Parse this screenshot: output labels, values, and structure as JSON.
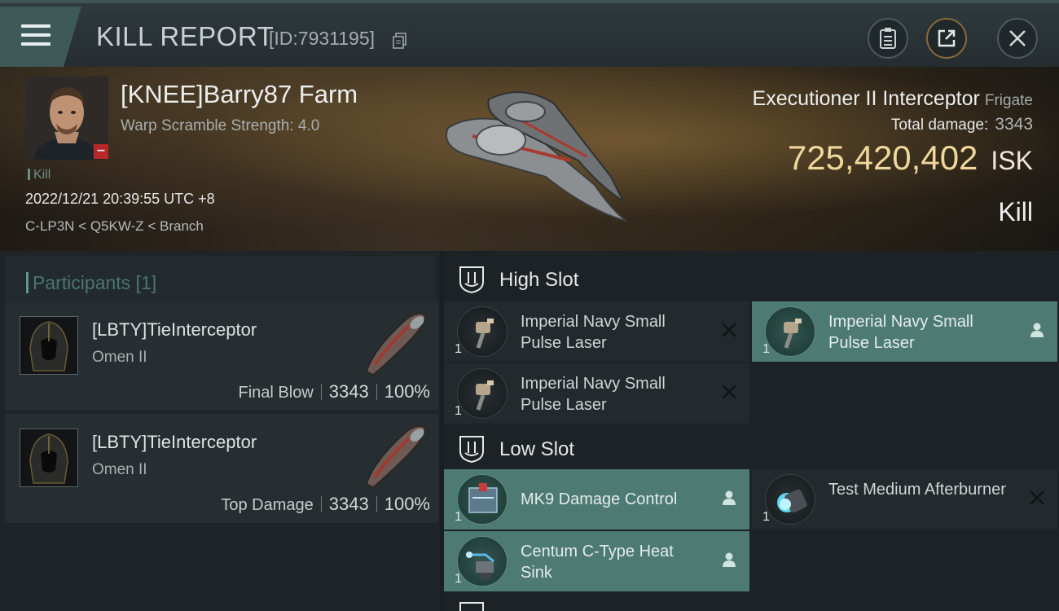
{
  "header": {
    "title": "KILL REPORT",
    "report_id": "[ID:7931195]",
    "icons": [
      "menu-icon",
      "copy-icon",
      "clipboard-icon",
      "share-icon",
      "close-icon"
    ]
  },
  "victim": {
    "name": "[KNEE]Barry87 Farm",
    "warp_scramble": "Warp Scramble Strength: 4.0",
    "tag": "Kill",
    "timestamp": "2022/12/21 20:39:55 UTC +8",
    "location": "C-LP3N < Q5KW-Z < Branch",
    "badge": "−"
  },
  "ship": {
    "name": "Executioner II Interceptor",
    "class": "Frigate",
    "total_damage_label": "Total damage:",
    "total_damage": "3343",
    "value": "725,420,402",
    "currency": "ISK",
    "result": "Kill"
  },
  "participants": {
    "title": "Participants [1]",
    "rows": [
      {
        "name": "[LBTY]TieInterceptor",
        "ship": "Omen II",
        "role": "Final Blow",
        "damage": "3343",
        "percent": "100%"
      },
      {
        "name": "[LBTY]TieInterceptor",
        "ship": "Omen II",
        "role": "Top Damage",
        "damage": "3343",
        "percent": "100%"
      }
    ]
  },
  "fitting": {
    "high_slot": {
      "label": "High Slot",
      "modules": [
        {
          "name": "Imperial Navy Small Pulse Laser",
          "qty": "1",
          "state": "destroyed"
        },
        {
          "name": "Imperial Navy Small Pulse Laser",
          "qty": "1",
          "state": "dropped"
        },
        {
          "name": "Imperial Navy Small Pulse Laser",
          "qty": "1",
          "state": "destroyed"
        }
      ]
    },
    "low_slot": {
      "label": "Low Slot",
      "modules": [
        {
          "name": "MK9 Damage Control",
          "qty": "1",
          "state": "dropped"
        },
        {
          "name": "Test Medium Afterburner",
          "qty": "1",
          "state": "destroyed"
        },
        {
          "name": "Centum C-Type Heat Sink",
          "qty": "1",
          "state": "dropped"
        }
      ]
    }
  },
  "colors": {
    "accent_teal": "#4d7a73",
    "isk_gold": "#f0d79c",
    "badge_red": "#b8282a"
  }
}
